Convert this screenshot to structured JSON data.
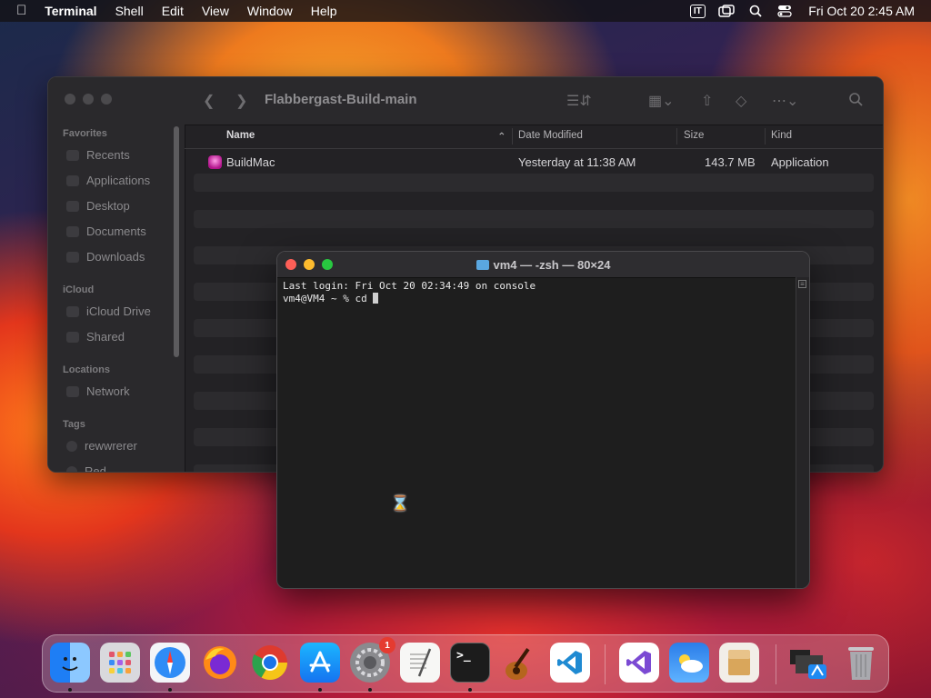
{
  "menubar": {
    "app_name": "Terminal",
    "menus": [
      "Shell",
      "Edit",
      "View",
      "Window",
      "Help"
    ],
    "input_source": "IT",
    "clock": "Fri Oct 20  2:45 AM"
  },
  "finder": {
    "path_title": "Flabbergast-Build-main",
    "sidebar": {
      "favorites_header": "Favorites",
      "favorites": [
        "Recents",
        "Applications",
        "Desktop",
        "Documents",
        "Downloads"
      ],
      "icloud_header": "iCloud",
      "icloud": [
        "iCloud Drive",
        "Shared"
      ],
      "locations_header": "Locations",
      "locations": [
        "Network"
      ],
      "tags_header": "Tags",
      "tags": [
        "rewwrerer",
        "Red"
      ]
    },
    "columns": {
      "name": "Name",
      "date": "Date Modified",
      "size": "Size",
      "kind": "Kind"
    },
    "files": [
      {
        "name": "BuildMac",
        "date": "Yesterday at 11:38 AM",
        "size": "143.7 MB",
        "kind": "Application"
      }
    ]
  },
  "terminal": {
    "title": "vm4 — -zsh — 80×24",
    "line1": "Last login: Fri Oct 20 02:34:49 on console",
    "line2": "vm4@VM4 ~ % cd "
  },
  "dock": {
    "settings_badge": "1",
    "apps": [
      "finder",
      "launchpad",
      "safari",
      "firefox",
      "chrome",
      "app-store",
      "system-settings",
      "textedit",
      "terminal",
      "garageband",
      "vscode",
      "visual-studio",
      "weather",
      "archive-utility",
      "downloads-stack",
      "trash"
    ]
  },
  "colors": {
    "accent": "#2f7cf6",
    "terminal_bg": "#1e1e1e",
    "badge": "#e53b30"
  }
}
